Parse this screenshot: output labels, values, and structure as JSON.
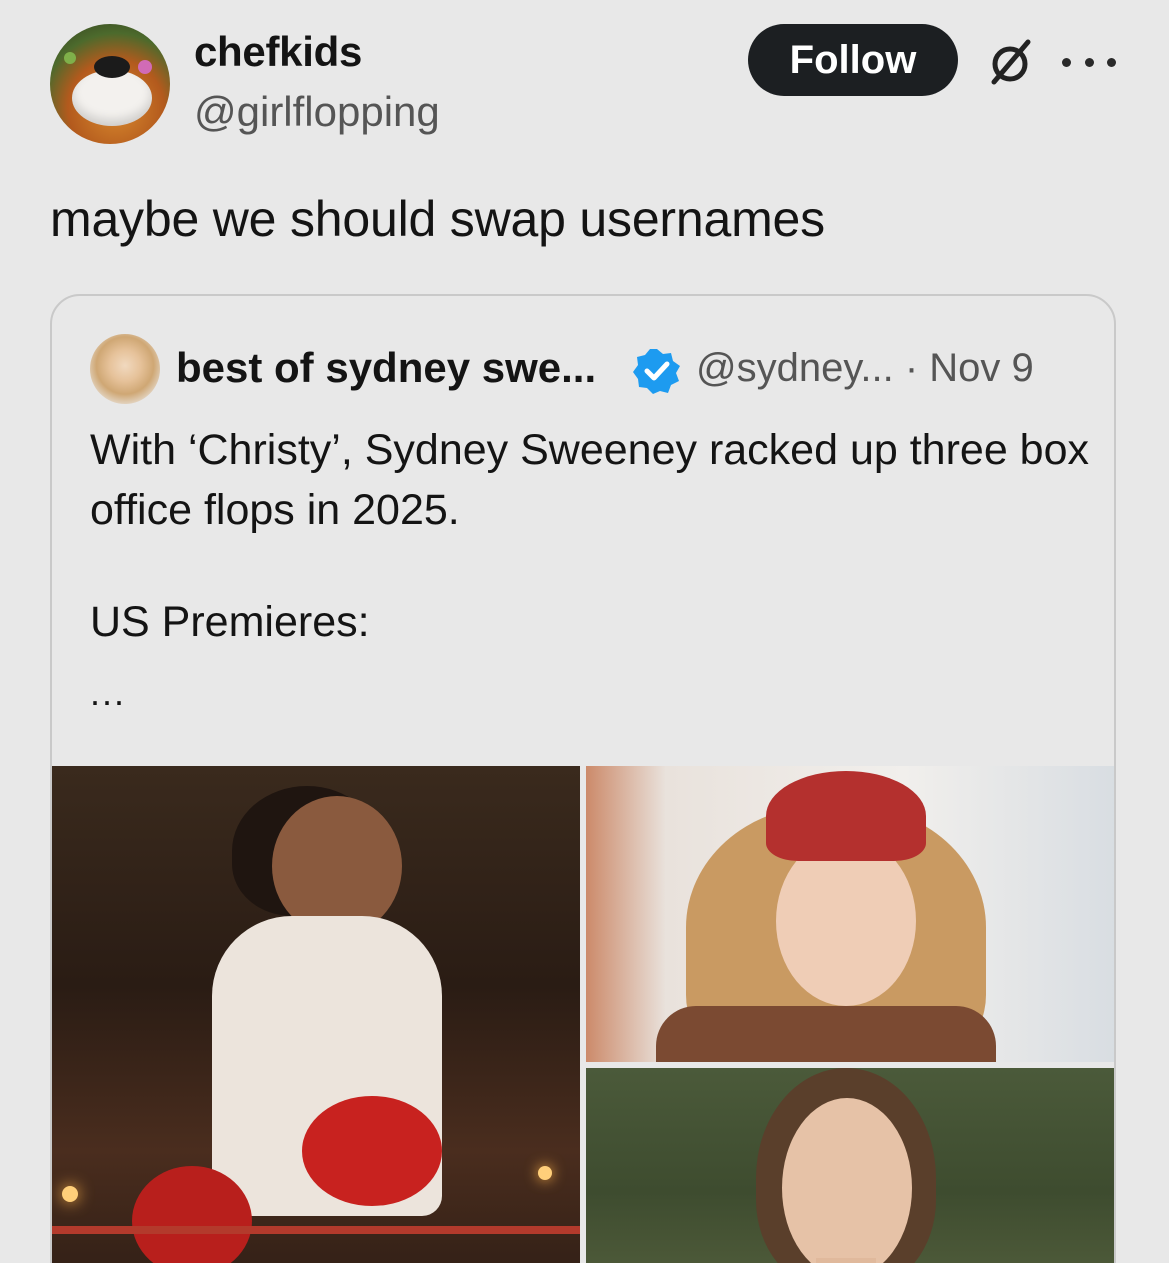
{
  "post": {
    "author": {
      "display_name": "chefkids",
      "handle": "@girlflopping",
      "avatar_icon": "avatar-food-plate"
    },
    "follow_label": "Follow",
    "grok_icon": "grok-slash-icon",
    "more_icon": "more-horizontal-icon",
    "text": "maybe we should swap usernames"
  },
  "quote": {
    "author": {
      "display_name": "best of sydney swe...",
      "handle_and_date": "@sydney... · Nov 9",
      "verified_icon": "verified-badge-icon",
      "verified_color": "#1d9bf0"
    },
    "text": "With ‘Christy’, Sydney Sweeney racked up three box office flops in 2025.",
    "premieres_label": "US Premieres:",
    "truncation": "..."
  },
  "colors": {
    "background": "#e8e8e8",
    "follow_button_bg": "#1c1f22",
    "secondary_text": "#555555"
  }
}
